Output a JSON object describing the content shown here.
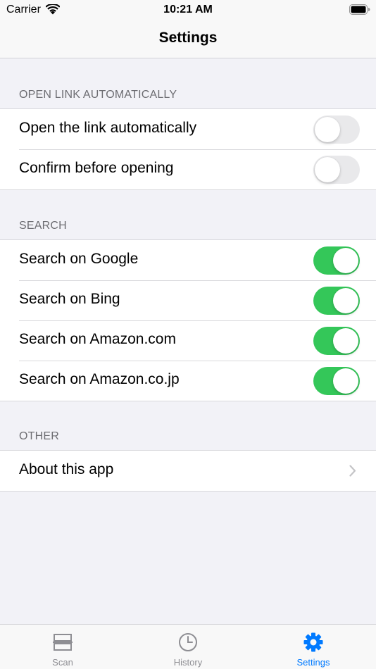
{
  "status_bar": {
    "carrier": "Carrier",
    "time": "10:21 AM"
  },
  "nav": {
    "title": "Settings"
  },
  "sections": [
    {
      "header": "OPEN LINK AUTOMATICALLY",
      "rows": [
        {
          "label": "Open the link automatically",
          "toggle": false
        },
        {
          "label": "Confirm before opening",
          "toggle": false
        }
      ]
    },
    {
      "header": "SEARCH",
      "rows": [
        {
          "label": "Search on Google",
          "toggle": true
        },
        {
          "label": "Search on Bing",
          "toggle": true
        },
        {
          "label": "Search on Amazon.com",
          "toggle": true
        },
        {
          "label": "Search on Amazon.co.jp",
          "toggle": true
        }
      ]
    },
    {
      "header": "OTHER",
      "rows": [
        {
          "label": "About this app",
          "icon": "chevron-right-icon"
        }
      ]
    }
  ],
  "tabs": [
    {
      "label": "Scan",
      "icon": "scan-icon",
      "active": false
    },
    {
      "label": "History",
      "icon": "clock-icon",
      "active": false
    },
    {
      "label": "Settings",
      "icon": "gear-icon",
      "active": true
    }
  ],
  "colors": {
    "accent": "#007aff",
    "toggle_on": "#34c759",
    "toggle_off": "#e9e9eb",
    "background": "#f2f2f7"
  }
}
